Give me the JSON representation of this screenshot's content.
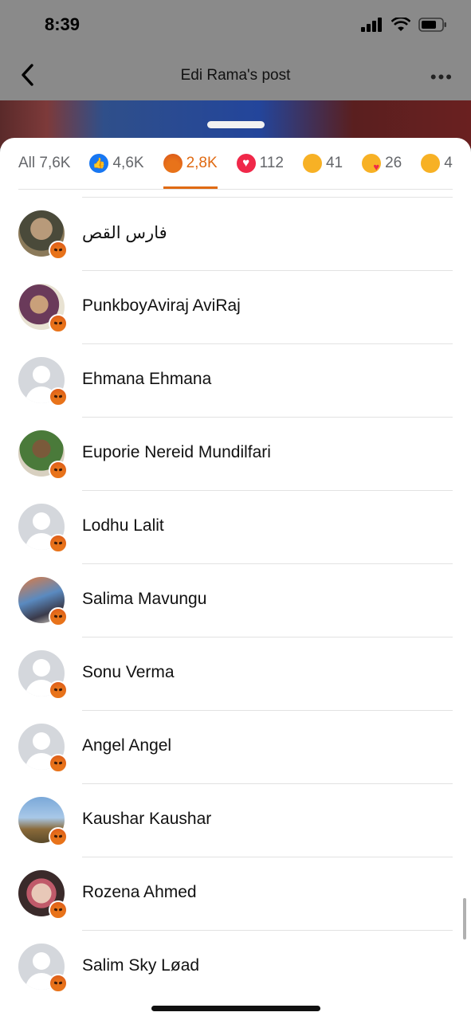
{
  "status_bar": {
    "time": "8:39"
  },
  "nav": {
    "title": "Edi Rama's post"
  },
  "tabs": [
    {
      "label": "All 7,6K",
      "icon": null
    },
    {
      "label": "4,6K",
      "icon": "like-icon"
    },
    {
      "label": "2,8K",
      "icon": "angry-icon",
      "active": true
    },
    {
      "label": "112",
      "icon": "love-icon"
    },
    {
      "label": "41",
      "icon": "haha-icon"
    },
    {
      "label": "26",
      "icon": "care-icon"
    },
    {
      "label": "4",
      "icon": "sad-icon"
    }
  ],
  "people": [
    {
      "name": "فارس القص",
      "avatar": "photo"
    },
    {
      "name": "PunkboyAviraj AviRaj",
      "avatar": "photo"
    },
    {
      "name": "Ehmana Ehmana",
      "avatar": "default"
    },
    {
      "name": "Euporie Nereid Mundilfari",
      "avatar": "photo"
    },
    {
      "name": "Lodhu Lalit",
      "avatar": "default"
    },
    {
      "name": "Salima Mavungu",
      "avatar": "photo"
    },
    {
      "name": "Sonu Verma",
      "avatar": "default"
    },
    {
      "name": "Angel Angel",
      "avatar": "default"
    },
    {
      "name": "Kaushar Kaushar",
      "avatar": "photo"
    },
    {
      "name": "Rozena Ahmed",
      "avatar": "photo"
    },
    {
      "name": "Salim Sky Løad",
      "avatar": "default"
    }
  ],
  "colors": {
    "accent": "#e06a12",
    "like": "#1877f2",
    "love": "#f02849",
    "separator": "#e2e2e2"
  }
}
